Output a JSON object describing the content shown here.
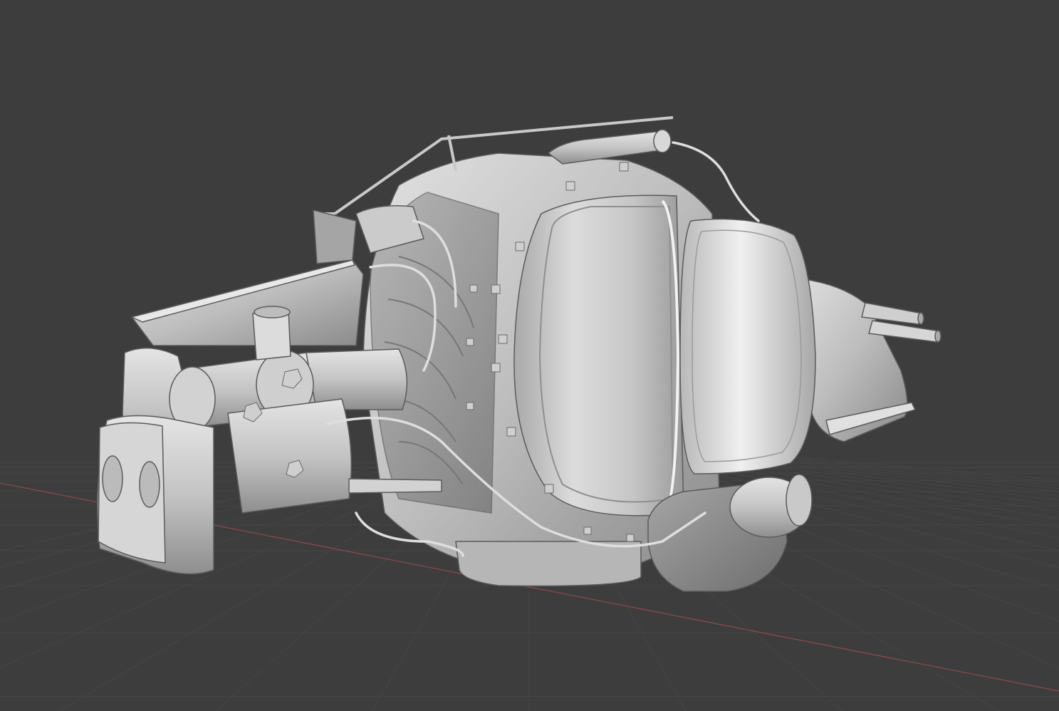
{
  "viewport": {
    "background_color": "#3d3d3d",
    "grid_line_color": "#454545",
    "x_axis_color": "#8a4a4a",
    "model_base_color": "#c8c8c8",
    "model_shadow_color": "#7a7a7a",
    "model_highlight_color": "#efefef",
    "shading_mode": "solid",
    "model": {
      "parts": [
        "engine-housing",
        "front-cover",
        "exhaust-duct",
        "hopper-tray",
        "cylinder-assembly",
        "twin-filter-block",
        "rear-pulley",
        "cable-harness",
        "top-rail"
      ]
    }
  }
}
